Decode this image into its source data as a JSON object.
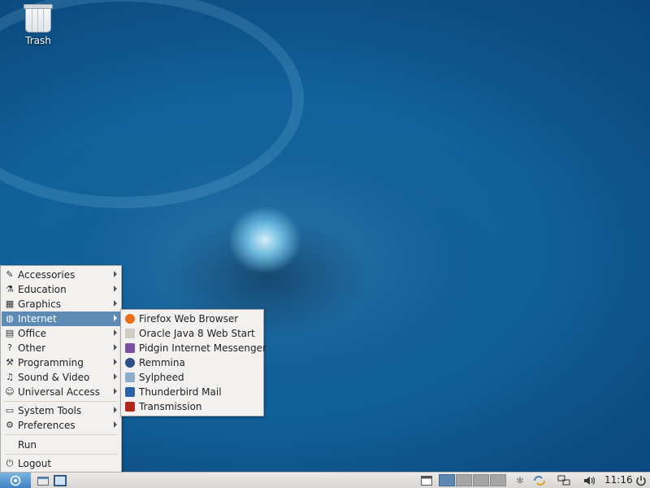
{
  "desktop": {
    "trash_label": "Trash"
  },
  "menu": {
    "items": [
      {
        "label": "Accessories",
        "icon": "accessories-icon",
        "glyph": "✎"
      },
      {
        "label": "Education",
        "icon": "education-icon",
        "glyph": "⚗"
      },
      {
        "label": "Graphics",
        "icon": "graphics-icon",
        "glyph": "▦"
      },
      {
        "label": "Internet",
        "icon": "internet-icon",
        "glyph": "◍"
      },
      {
        "label": "Office",
        "icon": "office-icon",
        "glyph": "▤"
      },
      {
        "label": "Other",
        "icon": "question-icon",
        "glyph": "?"
      },
      {
        "label": "Programming",
        "icon": "programming-icon",
        "glyph": "⚒"
      },
      {
        "label": "Sound & Video",
        "icon": "sound-video-icon",
        "glyph": "♫"
      },
      {
        "label": "Universal Access",
        "icon": "universal-access-icon",
        "glyph": "☺"
      },
      {
        "label": "System Tools",
        "icon": "system-tools-icon",
        "glyph": "▭"
      },
      {
        "label": "Preferences",
        "icon": "preferences-icon",
        "glyph": "⚙"
      },
      {
        "label": "Run",
        "icon": "run-icon",
        "glyph": ""
      },
      {
        "label": "Logout",
        "icon": "logout-icon",
        "glyph": "⏻"
      }
    ],
    "active_item": "Internet"
  },
  "submenu": {
    "items": [
      {
        "label": "Firefox Web Browser",
        "icon": "firefox-icon",
        "color": "#e8701d"
      },
      {
        "label": "Oracle Java 8 Web Start",
        "icon": "java-icon",
        "color": "#cfcac2"
      },
      {
        "label": "Pidgin Internet Messenger",
        "icon": "pidgin-icon",
        "color": "#7b4fa0"
      },
      {
        "label": "Remmina",
        "icon": "remmina-icon",
        "color": "#2f4f8a"
      },
      {
        "label": "Sylpheed",
        "icon": "sylpheed-icon",
        "color": "#8fa9c8"
      },
      {
        "label": "Thunderbird Mail",
        "icon": "thunderbird-icon",
        "color": "#2b63a8"
      },
      {
        "label": "Transmission",
        "icon": "transmission-icon",
        "color": "#b3261e"
      }
    ]
  },
  "panel": {
    "clock": "11:16",
    "workspaces": 4,
    "active_workspace": 1
  },
  "colors": {
    "menu_bg": "#f2f1f0",
    "highlight": "#5d8bb6",
    "panel_bg": "#dedcd9"
  }
}
